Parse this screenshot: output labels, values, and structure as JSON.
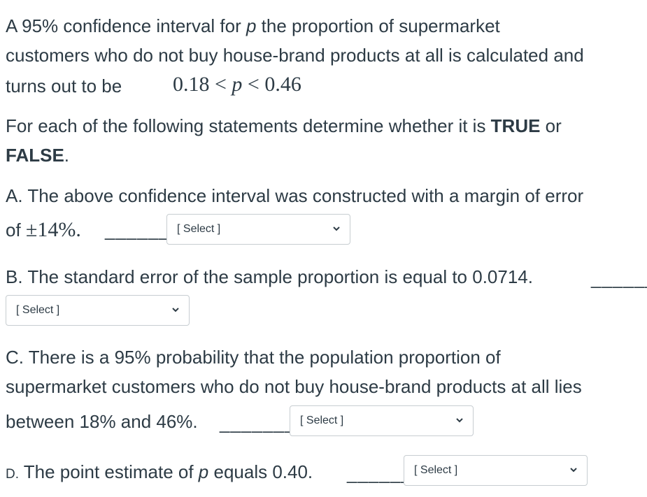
{
  "intro": {
    "line1_a": "A 95% confidence interval for ",
    "line1_var": "p",
    "line1_b": " the proportion of supermarket",
    "line2": "customers who do not buy house-brand products at all is calculated and",
    "line3": "turns out to be",
    "interval_math": "0.18 < p < 0.46",
    "interval_low": "0.18 < ",
    "interval_var": "p",
    "interval_high": " < 0.46"
  },
  "instructions": {
    "a": "For each of the following statements determine whether it is ",
    "true_word": "TRUE",
    "or": " or",
    "false_word": "FALSE",
    "period": "."
  },
  "questions": [
    {
      "letter": "A.",
      "line1": "A. The above confidence interval was constructed with a margin of error",
      "line2_a": "of ",
      "line2_math": "±14%.",
      "blank": "______",
      "select_value": "[ Select ]"
    },
    {
      "letter": "B.",
      "line1": "B. The standard error of the sample proportion is equal to 0.0714.",
      "blank": "______",
      "select_value": "[ Select ]"
    },
    {
      "letter": "C.",
      "line1": "C. There is a 95% probability that the population proportion of",
      "line2": "supermarket customers who do not buy house-brand products at all lies",
      "line3": "between 18% and 46%.",
      "blank": "_______",
      "select_value": "[ Select ]"
    },
    {
      "letter": "D.",
      "text_a": "The point estimate of ",
      "var": "p",
      "text_b": " equals 0.40.",
      "blank": "______",
      "select_value": "[ Select ]"
    }
  ]
}
